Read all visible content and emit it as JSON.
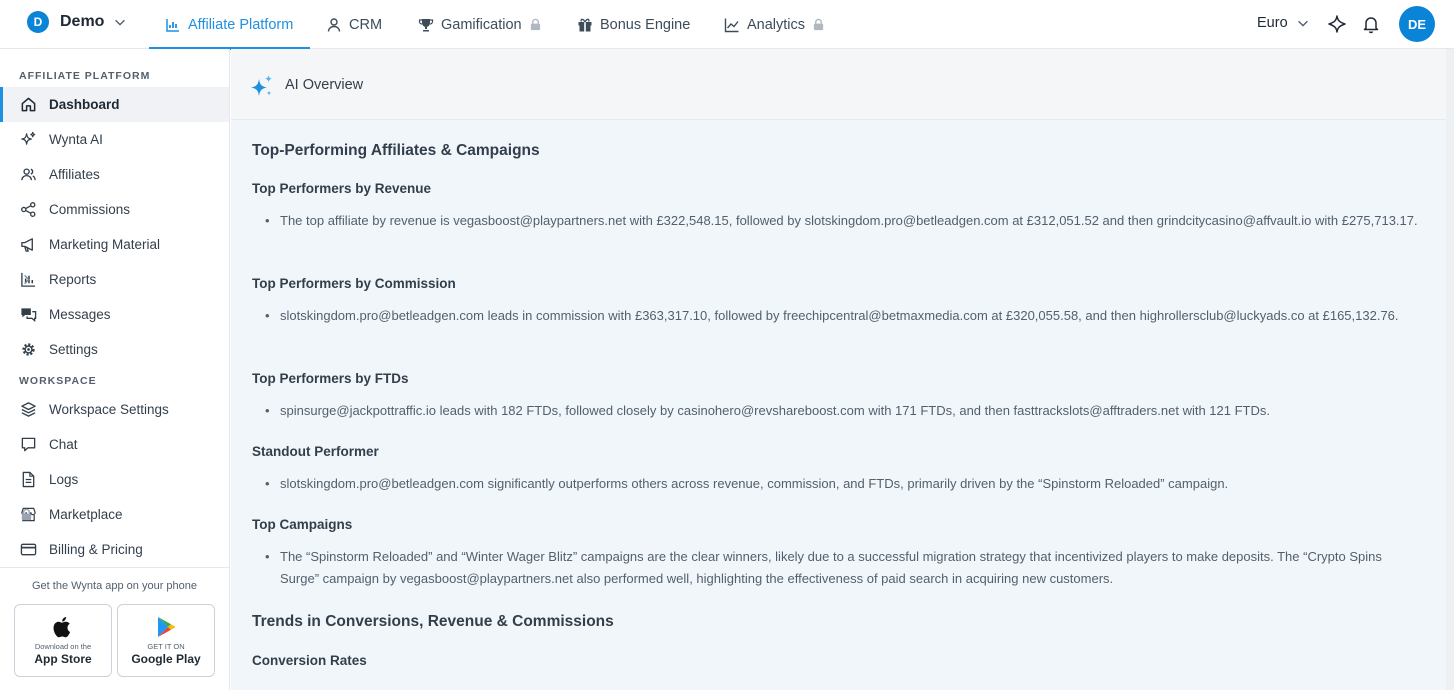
{
  "workspace": {
    "initial": "D",
    "name": "Demo"
  },
  "nav": {
    "tabs": [
      {
        "label": "Affiliate Platform",
        "icon": "bar-chart-icon",
        "locked": false
      },
      {
        "label": "CRM",
        "icon": "user-icon",
        "locked": false
      },
      {
        "label": "Gamification",
        "icon": "trophy-icon",
        "locked": true
      },
      {
        "label": "Bonus Engine",
        "icon": "gift-icon",
        "locked": false
      },
      {
        "label": "Analytics",
        "icon": "line-chart-icon",
        "locked": true
      }
    ],
    "active_tab": "Affiliate Platform"
  },
  "currency": "Euro",
  "user": {
    "initials": "DE"
  },
  "sidebar": {
    "section1": "AFFILIATE PLATFORM",
    "items": [
      {
        "label": "Dashboard",
        "icon": "home-icon",
        "active": true
      },
      {
        "label": "Wynta AI",
        "icon": "sparkle-icon"
      },
      {
        "label": "Affiliates",
        "icon": "users-icon"
      },
      {
        "label": "Commissions",
        "icon": "share-icon"
      },
      {
        "label": "Marketing Material",
        "icon": "megaphone-icon"
      },
      {
        "label": "Reports",
        "icon": "bar-chart-icon",
        "has_submenu": true
      },
      {
        "label": "Messages",
        "icon": "messages-icon"
      },
      {
        "label": "Settings",
        "icon": "gear-icon"
      }
    ],
    "section2": "WORKSPACE",
    "workspace_items": [
      {
        "label": "Workspace Settings",
        "icon": "layers-icon"
      },
      {
        "label": "Chat",
        "icon": "chat-icon"
      },
      {
        "label": "Logs",
        "icon": "document-icon"
      },
      {
        "label": "Marketplace",
        "icon": "store-icon",
        "locked": true
      },
      {
        "label": "Billing & Pricing",
        "icon": "card-icon"
      }
    ],
    "app_promo": "Get the Wynta app on your phone",
    "app_store": {
      "small": "Download on the",
      "big": "App Store"
    },
    "google_play": {
      "small": "GET IT ON",
      "big": "Google Play"
    }
  },
  "ai_overview": {
    "title": "AI Overview",
    "section1_title": "Top-Performing Affiliates & Campaigns",
    "revenue_title": "Top Performers by Revenue",
    "revenue_text": "The top affiliate by revenue is vegasboost@playpartners.net with £322,548.15, followed by slotskingdom.pro@betleadgen.com at £312,051.52 and then grindcitycasino@affvault.io with £275,713.17.",
    "commission_title": "Top Performers by Commission",
    "commission_text": "slotskingdom.pro@betleadgen.com leads in commission with £363,317.10, followed by freechipcentral@betmaxmedia.com at £320,055.58, and then highrollersclub@luckyads.co at £165,132.76.",
    "ftd_title": "Top Performers by FTDs",
    "ftd_text": "spinsurge@jackpottraffic.io leads with 182 FTDs, followed closely by casinohero@revshareboost.com with 171 FTDs, and then fasttrackslots@afftraders.net with 121 FTDs.",
    "standout_title": "Standout Performer",
    "standout_text": "slotskingdom.pro@betleadgen.com significantly outperforms others across revenue, commission, and FTDs, primarily driven by the “Spinstorm Reloaded” campaign.",
    "campaigns_title": "Top Campaigns",
    "campaigns_text": "The “Spinstorm Reloaded” and “Winter Wager Blitz” campaigns are the clear winners, likely due to a successful migration strategy that incentivized players to make deposits. The “Crypto Spins Surge” campaign by vegasboost@playpartners.net also performed well, highlighting the effectiveness of paid search in acquiring new customers.",
    "section2_title": "Trends in Conversions, Revenue & Commissions",
    "conversion_title": "Conversion Rates"
  }
}
